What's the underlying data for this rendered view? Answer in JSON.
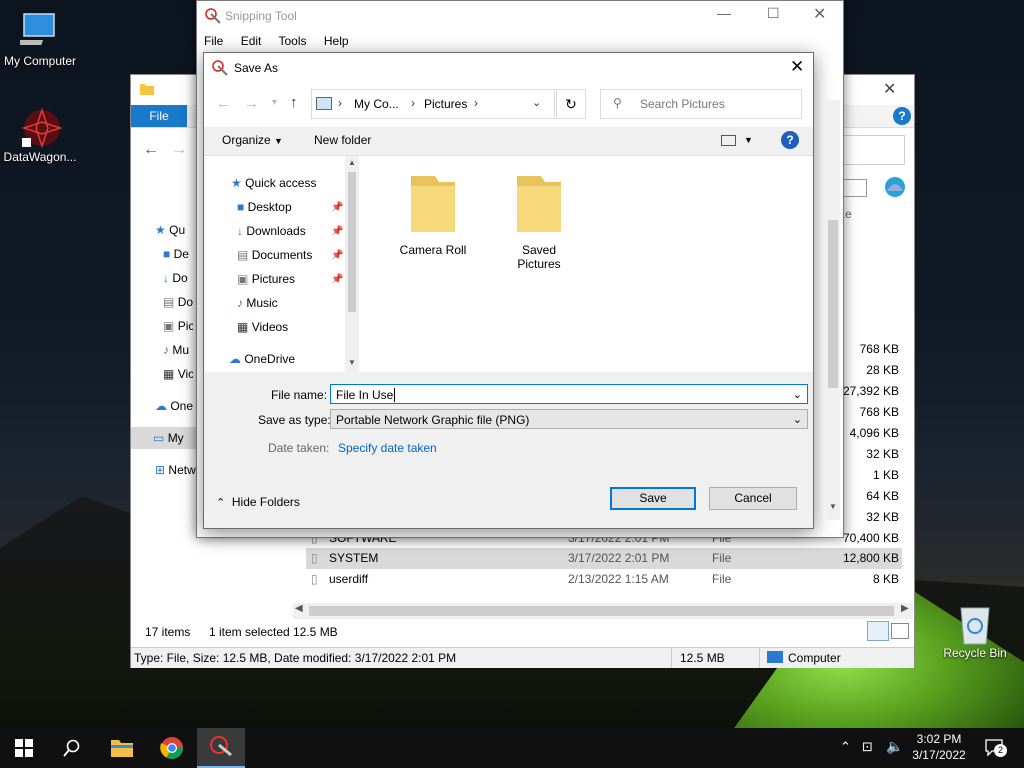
{
  "desktop": {
    "icons": [
      {
        "label": "My Computer"
      },
      {
        "label": "DataWagon..."
      },
      {
        "label": "Recycle Bin"
      }
    ]
  },
  "explorer": {
    "file_tab": "File",
    "nav_items": [
      "Quic",
      "De",
      "Do",
      "Do",
      "Pic",
      "Mu",
      "Vic",
      "One",
      "My",
      "Netw"
    ],
    "col_size_partial": "ze",
    "sizes": [
      "768 KB",
      "28 KB",
      "27,392 KB",
      "768 KB",
      "4,096 KB",
      "32 KB",
      "1 KB",
      "64 KB",
      "32 KB",
      "70,400 KB"
    ],
    "rows": [
      {
        "name": "SOFTWARE",
        "date": "3/17/2022 2:01 PM",
        "type": "File",
        "size": "70,400 KB"
      },
      {
        "name": "SYSTEM",
        "date": "3/17/2022 2:01 PM",
        "type": "File",
        "size": "12,800 KB"
      },
      {
        "name": "userdiff",
        "date": "2/13/2022 1:15 AM",
        "type": "File",
        "size": "8 KB"
      }
    ],
    "status": {
      "items_count": "17 items",
      "selected": "1 item selected",
      "selected_size": "12.5 MB"
    },
    "details_bar": {
      "info": "Type: File, Size: 12.5 MB, Date modified: 3/17/2022 2:01 PM",
      "size": "12.5 MB",
      "location": "Computer"
    }
  },
  "snipping_tool": {
    "title": "Snipping Tool",
    "menu": [
      "File",
      "Edit",
      "Tools",
      "Help"
    ]
  },
  "save_as": {
    "title": "Save As",
    "breadcrumb": [
      "My Co...",
      "Pictures"
    ],
    "search_placeholder": "Search Pictures",
    "organize": "Organize",
    "new_folder": "New folder",
    "nav": [
      {
        "label": "Quick access",
        "pinned": false
      },
      {
        "label": "Desktop",
        "pinned": true
      },
      {
        "label": "Downloads",
        "pinned": true
      },
      {
        "label": "Documents",
        "pinned": true
      },
      {
        "label": "Pictures",
        "pinned": true
      },
      {
        "label": "Music",
        "pinned": false
      },
      {
        "label": "Videos",
        "pinned": false
      },
      {
        "label": "OneDrive",
        "pinned": false
      }
    ],
    "folders": [
      "Camera Roll",
      "Saved Pictures"
    ],
    "file_name_label": "File name:",
    "file_name_value": "File In Use",
    "save_type_label": "Save as type:",
    "save_type_value": "Portable Network Graphic file (PNG)",
    "date_taken_label": "Date taken:",
    "date_taken_link": "Specify date taken",
    "hide_folders": "Hide Folders",
    "save_button": "Save",
    "cancel_button": "Cancel"
  },
  "taskbar": {
    "time": "3:02 PM",
    "date": "3/17/2022",
    "notification_count": "2"
  }
}
